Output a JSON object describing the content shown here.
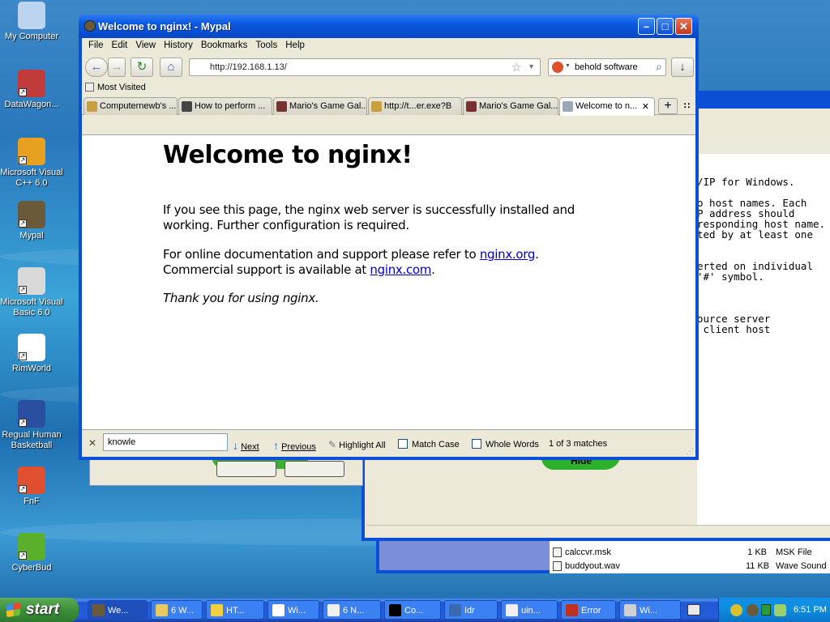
{
  "desktop": {
    "icons": [
      {
        "label": "My Computer",
        "color": "#bcd4f0"
      },
      {
        "label": "DataWagon...",
        "color": "#c23b3b"
      },
      {
        "label": "Microsoft Visual C++ 6.0",
        "color": "#e8a020"
      },
      {
        "label": "Mypal",
        "color": "#6b5a3a"
      },
      {
        "label": "Microsoft Visual Basic 6.0",
        "color": "#d9d9d9"
      },
      {
        "label": "RimWorld",
        "color": "#ffffff"
      },
      {
        "label": "Regual Human Basketball",
        "color": "#2a4fa0"
      },
      {
        "label": "FnF",
        "color": "#e05030"
      },
      {
        "label": "CyberBud",
        "color": "#5ab02a"
      }
    ]
  },
  "background_console": {
    "lines": [
      "/IP for Windows.",
      "",
      "o host names. Each",
      "P address should",
      "responding host name.",
      "ted by at least one",
      "",
      "",
      "erted on individual",
      "'#' symbol.",
      "",
      "",
      "",
      "ource server",
      " client host"
    ]
  },
  "background_explorer": {
    "files": [
      {
        "name": "calccvr.msk",
        "size": "1 KB",
        "type": "MSK File"
      },
      {
        "name": "buddyout.wav",
        "size": "11 KB",
        "type": "Wave Sound"
      }
    ]
  },
  "background_dialog": {
    "hide_label": "Hide"
  },
  "browser": {
    "title": "Welcome to nginx! - Mypal",
    "menu": [
      "File",
      "Edit",
      "View",
      "History",
      "Bookmarks",
      "Tools",
      "Help"
    ],
    "url": "http://192.168.1.13/",
    "search_value": "behold software",
    "bookmark": "Most Visited",
    "tabs": [
      {
        "label": "Computernewb's ...",
        "color": "#c8a040"
      },
      {
        "label": "How to perform ...",
        "color": "#444444"
      },
      {
        "label": "Mario's Game Gal...",
        "color": "#7a3030"
      },
      {
        "label": "http://t...er.exe?B",
        "color": "#c8a040"
      },
      {
        "label": "Mario's Game Gal...",
        "color": "#7a3030"
      },
      {
        "label": "Welcome to n...",
        "color": "#9aa8b8"
      }
    ],
    "page": {
      "heading": "Welcome to nginx!",
      "p1_line1": "If you see this page, the nginx web server is successfully installed and",
      "p1_line2": "working. Further configuration is required.",
      "p2_line1_pre": "For online documentation and support please refer to ",
      "p2_link1": "nginx.org",
      "p2_line1_post": ".",
      "p2_line2_pre": "Commercial support is available at ",
      "p2_link2": "nginx.com",
      "p2_line2_post": ".",
      "p3": "Thank you for using nginx."
    },
    "findbar": {
      "query": "knowle",
      "next": "Next",
      "previous": "Previous",
      "highlight_all": "Highlight All",
      "match_case": "Match Case",
      "whole_words": "Whole Words",
      "status": "1 of 3 matches"
    }
  },
  "taskbar": {
    "start": "start",
    "items": [
      {
        "label": "We...",
        "color": "#6b5a3a"
      },
      {
        "label": "6 W...",
        "color": "#e8c860"
      },
      {
        "label": "HT...",
        "color": "#f0d040"
      },
      {
        "label": "Wi...",
        "color": "#ffffff"
      },
      {
        "label": "6 N...",
        "color": "#f0f0f0"
      },
      {
        "label": "Co...",
        "color": "#000000"
      },
      {
        "label": "Idr",
        "color": "#3a6ab0"
      },
      {
        "label": "uin...",
        "color": "#f0f0f0"
      },
      {
        "label": "Error",
        "color": "#c03020"
      },
      {
        "label": "Wi...",
        "color": "#d0d0d0"
      }
    ],
    "clock": "6:51 PM"
  }
}
